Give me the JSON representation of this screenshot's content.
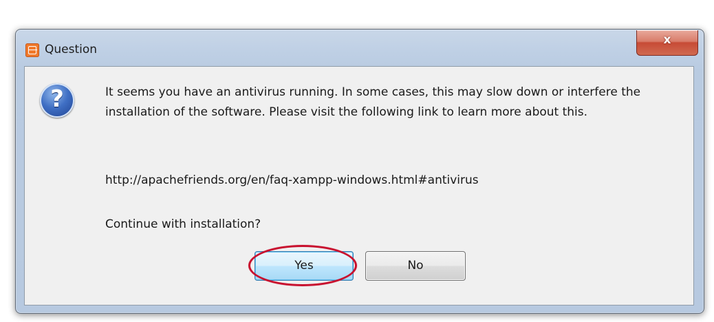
{
  "window": {
    "title": "Question",
    "close_glyph": "x"
  },
  "icons": {
    "app_icon": "xampp-icon",
    "message_icon": "question-icon",
    "message_icon_glyph": "?"
  },
  "message": {
    "body": "It seems you have an antivirus running. In some cases, this may slow down or interfere the installation of the software. Please visit the following link to learn more about this.",
    "url": "http://apachefriends.org/en/faq-xampp-windows.html#antivirus",
    "prompt": "Continue with installation?"
  },
  "buttons": {
    "yes_label": "Yes",
    "no_label": "No"
  },
  "colors": {
    "highlight_ring": "#c8102e",
    "close_button": "#c74b36",
    "window_frame": "#b9cbe1",
    "client_bg": "#f0f0f0",
    "default_button_border": "#3c7fb1"
  }
}
